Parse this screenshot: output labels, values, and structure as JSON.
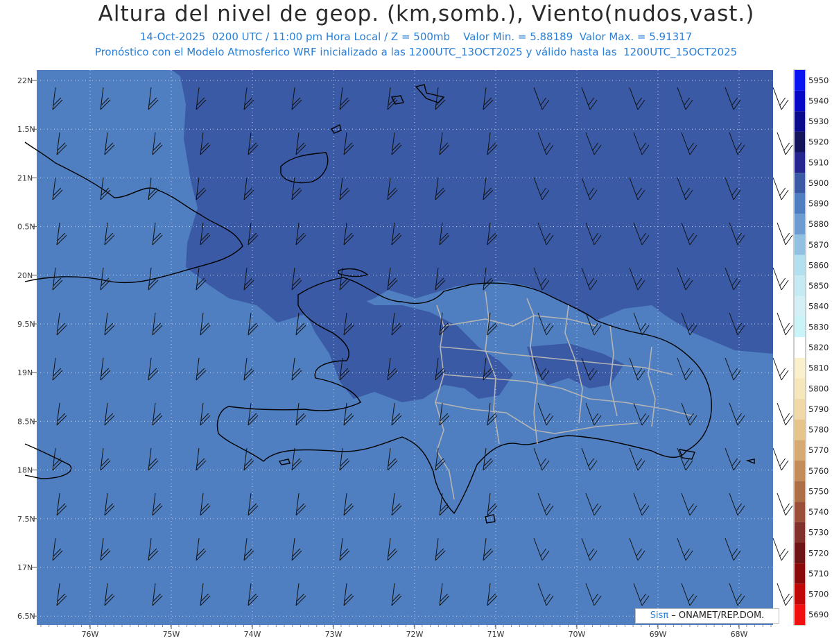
{
  "header": {
    "title": "Altura del nivel de geop. (km,somb.), Viento(nudos,vast.)",
    "line1": "14-Oct-2025  0200 UTC / 11:00 pm Hora Local / Z = 500mb    Valor Min. = 5.88189  Valor Max. = 5.91317",
    "line2": "Pronóstico con el Modelo Atmosferico WRF inicializado a las 1200UTC_13OCT2025 y válido hasta las  1200UTC_15OCT2025"
  },
  "map": {
    "lat_labels": [
      "22N",
      "1.5N",
      "21N",
      "0.5N",
      "20N",
      "9.5N",
      "19N",
      "8.5N",
      "18N",
      "7.5N",
      "17N",
      "6.5N"
    ],
    "lon_labels": [
      "76W",
      "75W",
      "74W",
      "73W",
      "72W",
      "71W",
      "70W",
      "69W",
      "68W"
    ],
    "fill_colors": {
      "band_5890": "#4f7fc0",
      "band_5900": "#3a5aa6",
      "land": "#3a5aa6"
    }
  },
  "colorbar": {
    "levels": [
      "5950",
      "5940",
      "5930",
      "5920",
      "5910",
      "5900",
      "5890",
      "5880",
      "5870",
      "5860",
      "5850",
      "5840",
      "5830",
      "5820",
      "5810",
      "5800",
      "5790",
      "5780",
      "5770",
      "5760",
      "5750",
      "5740",
      "5730",
      "5720",
      "5710",
      "5700",
      "5690"
    ],
    "colors": [
      "#0a14f0",
      "#0707c8",
      "#0a0a8c",
      "#14145c",
      "#262690",
      "#3a5aa6",
      "#4f7fc0",
      "#6d9cd0",
      "#92c0e0",
      "#b2e0ee",
      "#c6eaf4",
      "#d4f0f6",
      "#c8f4f8",
      "#ffffff",
      "#fbf0cc",
      "#f6e6bb",
      "#f0d9a6",
      "#e6c48c",
      "#d6aa72",
      "#c48c58",
      "#ae6e46",
      "#9a5038",
      "#82302c",
      "#6e1416",
      "#8a0a0a",
      "#c00808",
      "#f01010"
    ]
  },
  "credit": {
    "sis": "Sisπ",
    "rest": " – ONAMET/REP.DOM."
  }
}
